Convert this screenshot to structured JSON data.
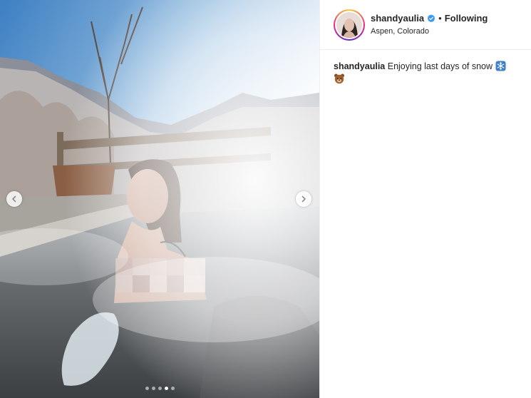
{
  "header": {
    "username": "shandyaulia",
    "separator": "•",
    "follow_status": "Following",
    "location": "Aspen, Colorado"
  },
  "caption": {
    "username": "shandyaulia",
    "text": "Enjoying last days of snow",
    "emojis": [
      "snowflake-icon",
      "bear-icon"
    ]
  },
  "carousel": {
    "slide_count": 5,
    "active_index": 3
  },
  "colors": {
    "verified": "#3897f0",
    "text": "#262626",
    "border": "#efefef"
  }
}
